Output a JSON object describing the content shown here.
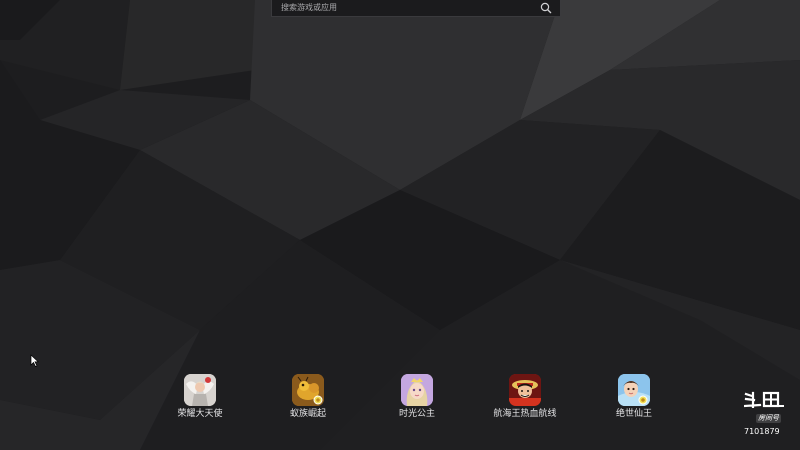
{
  "search": {
    "placeholder": "搜索游戏或应用",
    "icon": "search-icon"
  },
  "apps": [
    {
      "label": "荣耀大天使",
      "icon": "angel-game-icon"
    },
    {
      "label": "蚁族崛起",
      "icon": "ant-game-icon"
    },
    {
      "label": "时光公主",
      "icon": "princess-game-icon"
    },
    {
      "label": "航海王热血航线",
      "icon": "one-piece-game-icon"
    },
    {
      "label": "绝世仙王",
      "icon": "immortal-king-game-icon"
    }
  ],
  "watermark": {
    "logo_text": "斗鱼",
    "room_label": "房间号",
    "room_number": "7101879"
  },
  "colors": {
    "background": "#1e1e20",
    "text": "#e4e4e6"
  }
}
